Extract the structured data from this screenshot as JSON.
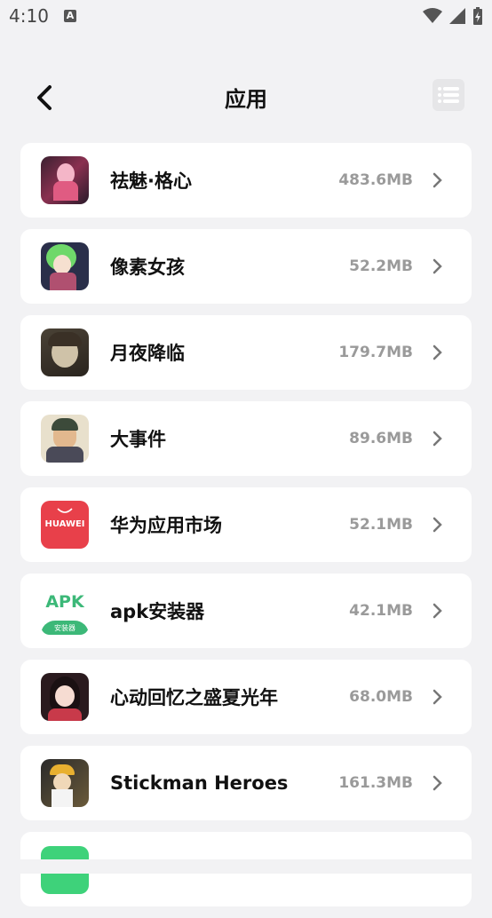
{
  "status": {
    "time": "4:10"
  },
  "header": {
    "title": "应用"
  },
  "apps": [
    {
      "name": "祛魅·格心",
      "size": "483.6MB",
      "icon": "game-icon-girl-pink"
    },
    {
      "name": "像素女孩",
      "size": "52.2MB",
      "icon": "game-icon-green-hair"
    },
    {
      "name": "月夜降临",
      "size": "179.7MB",
      "icon": "game-icon-dark-portrait"
    },
    {
      "name": "大事件",
      "size": "89.6MB",
      "icon": "game-icon-comic-man"
    },
    {
      "name": "华为应用市场",
      "size": "52.1MB",
      "icon": "huawei-appgallery-icon",
      "icon_text": "HUAWEI"
    },
    {
      "name": "apk安装器",
      "size": "42.1MB",
      "icon": "apk-installer-icon",
      "icon_text": "APK",
      "icon_subtext": "安装器"
    },
    {
      "name": "心动回忆之盛夏光年",
      "size": "68.0MB",
      "icon": "game-icon-anime-girl"
    },
    {
      "name": "Stickman Heroes",
      "size": "161.3MB",
      "icon": "game-icon-stickman"
    },
    {
      "name": "",
      "size": "",
      "icon": "green-app-icon-partial"
    }
  ],
  "colors": {
    "background": "#f2f2f4",
    "card": "#ffffff",
    "size_text": "#9a9a9a",
    "huawei_red": "#e8404a",
    "apk_green": "#3cb878"
  }
}
